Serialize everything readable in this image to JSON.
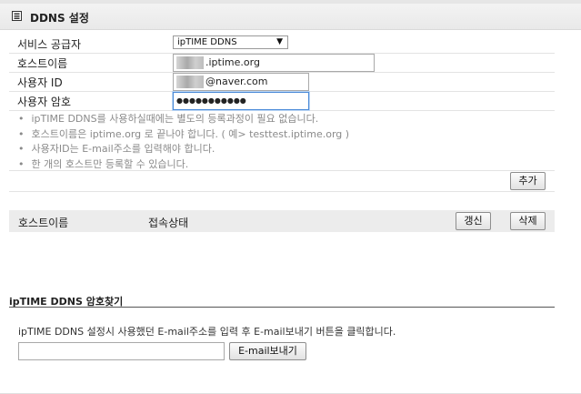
{
  "header": {
    "title": "DDNS 설정",
    "icon": "list-icon"
  },
  "form": {
    "provider": {
      "label": "서비스 공급자",
      "value": "ipTIME DDNS",
      "arrow": "▼"
    },
    "hostname": {
      "label": "호스트이름",
      "value": ".iptime.org"
    },
    "user_id": {
      "label": "사용자 ID",
      "value": "@naver.com"
    },
    "password": {
      "label": "사용자 암호",
      "value": "●●●●●●●●●●●"
    }
  },
  "notes": [
    "ipTIME DDNS를 사용하실때에는 별도의 등록과정이 필요 없습니다.",
    "호스트이름은 iptime.org 로 끝나야 합니다. ( 예> testtest.iptime.org )",
    "사용자ID는 E-mail주소를 입력해야 합니다.",
    "한 개의 호스트만 등록할 수 있습니다."
  ],
  "buttons": {
    "add": "추가",
    "renew": "갱신",
    "delete": "삭제",
    "send_email": "E-mail보내기"
  },
  "host_table": {
    "col_host": "호스트이름",
    "col_status": "접속상태"
  },
  "recovery": {
    "title": "ipTIME DDNS 암호찾기",
    "description": "ipTIME DDNS 설정시 사용했던 E-mail주소를 입력 후 E-mail보내기 버튼을 클릭합니다.",
    "email_value": ""
  }
}
